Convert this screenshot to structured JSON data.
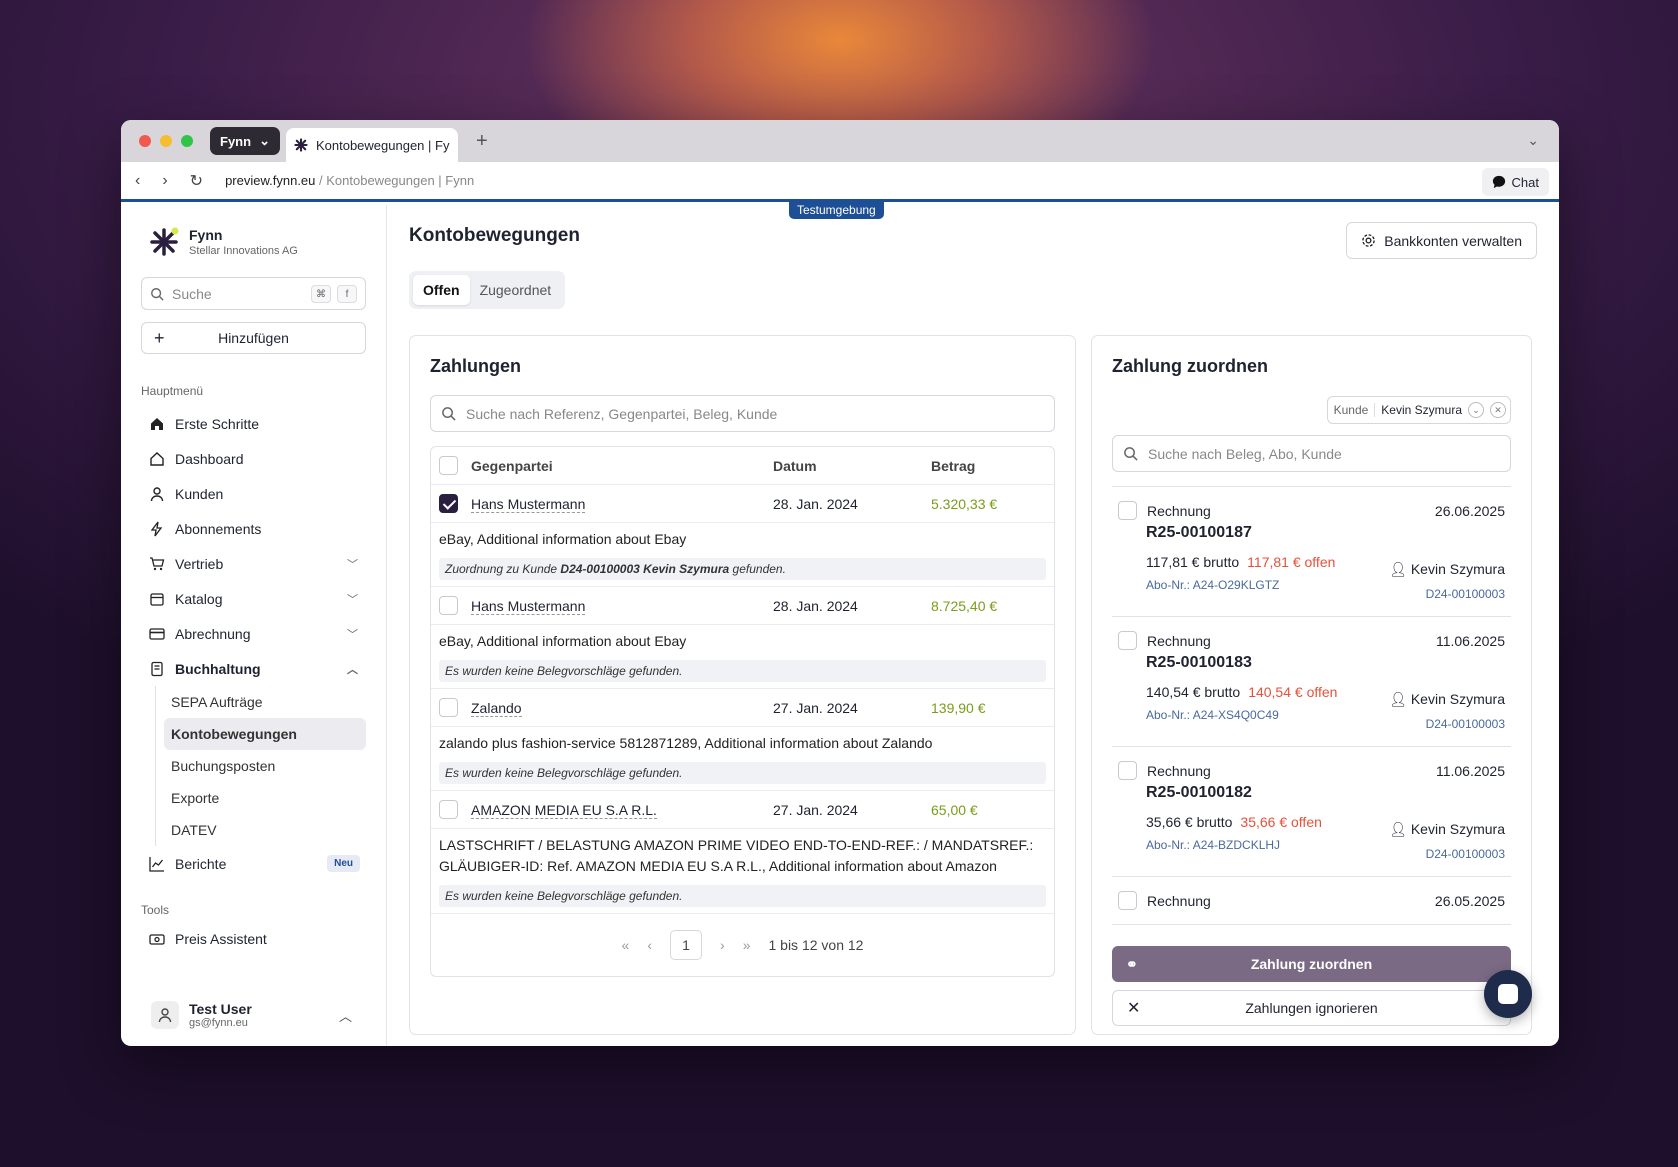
{
  "browser": {
    "profile": "Fynn",
    "tab_title": "Kontobewegungen | Fy",
    "url_host": "preview.fynn.eu",
    "url_path": " / Kontobewegungen | Fynn",
    "chat_label": "Chat",
    "env_badge": "Testumgebung"
  },
  "sidebar": {
    "brand_name": "Fynn",
    "brand_sub": "Stellar Innovations AG",
    "search_placeholder": "Suche",
    "kbd1": "⌘",
    "kbd2": "f",
    "add_label": "Hinzufügen",
    "main_menu_label": "Hauptmenü",
    "items": [
      {
        "label": "Erste Schritte",
        "icon": "home-icon"
      },
      {
        "label": "Dashboard",
        "icon": "dashboard-icon"
      },
      {
        "label": "Kunden",
        "icon": "user-icon"
      },
      {
        "label": "Abonnements",
        "icon": "bolt-icon"
      },
      {
        "label": "Vertrieb",
        "icon": "cart-icon"
      },
      {
        "label": "Katalog",
        "icon": "catalog-icon"
      },
      {
        "label": "Abrechnung",
        "icon": "billing-icon"
      },
      {
        "label": "Buchhaltung",
        "icon": "accounting-icon"
      }
    ],
    "sub_items": [
      "SEPA Aufträge",
      "Kontobewegungen",
      "Buchungsposten",
      "Exporte",
      "DATEV"
    ],
    "reports_label": "Berichte",
    "reports_badge": "Neu",
    "tools_label": "Tools",
    "price_assistant": "Preis Assistent",
    "user_name": "Test User",
    "user_email": "gs@fynn.eu"
  },
  "main": {
    "title": "Kontobewegungen",
    "bank_button": "Bankkonten verwalten",
    "tabs": [
      "Offen",
      "Zugeordnet"
    ]
  },
  "payments": {
    "title": "Zahlungen",
    "search_placeholder": "Suche nach Referenz, Gegenpartei, Beleg, Kunde",
    "col_party": "Gegenpartei",
    "col_date": "Datum",
    "col_amount": "Betrag",
    "rows": [
      {
        "party": "Hans Mustermann",
        "date": "28. Jan. 2024",
        "amount": "5.320,33 €",
        "desc": "eBay, Additional information about Ebay",
        "note_pre": "Zuordnung zu Kunde ",
        "note_bold": "D24-00100003 Kevin Szymura",
        "note_post": " gefunden."
      },
      {
        "party": "Hans Mustermann",
        "date": "28. Jan. 2024",
        "amount": "8.725,40 €",
        "desc": "eBay, Additional information about Ebay",
        "note": "Es wurden keine Belegvorschläge gefunden."
      },
      {
        "party": "Zalando",
        "date": "27. Jan. 2024",
        "amount": "139,90 €",
        "desc": "zalando plus fashion-service 5812871289, Additional information about Zalando",
        "note": "Es wurden keine Belegvorschläge gefunden."
      },
      {
        "party": "AMAZON MEDIA EU S.A R.L.",
        "date": "27. Jan. 2024",
        "amount": "65,00 €",
        "desc": "LASTSCHRIFT / BELASTUNG AMAZON PRIME VIDEO END-TO-END-REF.: / MANDATSREF.: GLÄUBIGER-ID: Ref. AMAZON MEDIA EU S.A R.L., Additional information about Amazon",
        "note": "Es wurden keine Belegvorschläge gefunden."
      }
    ],
    "pager": {
      "page": "1",
      "summary": "1 bis 12 von 12"
    }
  },
  "assign": {
    "title": "Zahlung zuordnen",
    "filter_key": "Kunde",
    "filter_value": "Kevin Szymura",
    "search_placeholder": "Suche nach Beleg, Abo, Kunde",
    "invoices": [
      {
        "type": "Rechnung",
        "date": "26.06.2025",
        "number": "R25-00100187",
        "gross": "117,81 € brutto",
        "open": "117,81 € offen",
        "customer": "Kevin Szymura",
        "abo": "Abo-Nr.: A24-O29KLGTZ",
        "debtor": "D24-00100003"
      },
      {
        "type": "Rechnung",
        "date": "11.06.2025",
        "number": "R25-00100183",
        "gross": "140,54 € brutto",
        "open": "140,54 € offen",
        "customer": "Kevin Szymura",
        "abo": "Abo-Nr.: A24-XS4Q0C49",
        "debtor": "D24-00100003"
      },
      {
        "type": "Rechnung",
        "date": "11.06.2025",
        "number": "R25-00100182",
        "gross": "35,66 € brutto",
        "open": "35,66 € offen",
        "customer": "Kevin Szymura",
        "abo": "Abo-Nr.: A24-BZDCKLHJ",
        "debtor": "D24-00100003"
      },
      {
        "type": "Rechnung",
        "date": "26.05.2025"
      }
    ],
    "assign_button": "Zahlung zuordnen",
    "ignore_button": "Zahlungen ignorieren"
  }
}
